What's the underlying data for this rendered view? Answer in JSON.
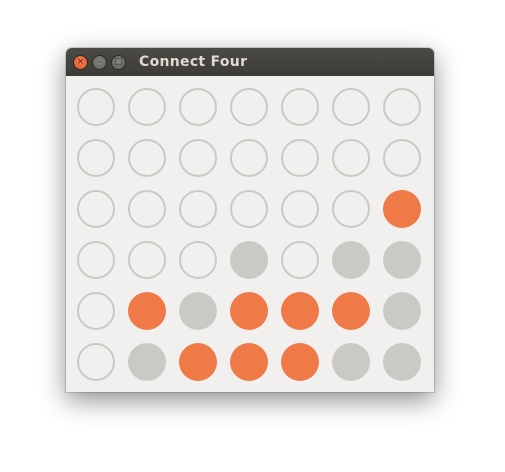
{
  "window": {
    "title": "Connect Four",
    "buttons": {
      "close_icon": "×",
      "minimize_icon": "–",
      "maximize_icon": "□"
    }
  },
  "colors": {
    "orange": "#f07a47",
    "gray": "#cbc9c6",
    "empty_outline": "#cbc9c6",
    "board_background": "#f1f0ef",
    "titlebar": "#3c3b37"
  },
  "board": {
    "rows": 6,
    "cols": 7,
    "cells": [
      [
        "empty",
        "empty",
        "empty",
        "empty",
        "empty",
        "empty",
        "empty"
      ],
      [
        "empty",
        "empty",
        "empty",
        "empty",
        "empty",
        "empty",
        "empty"
      ],
      [
        "empty",
        "empty",
        "empty",
        "empty",
        "empty",
        "empty",
        "orange"
      ],
      [
        "empty",
        "empty",
        "empty",
        "gray",
        "empty",
        "gray",
        "gray"
      ],
      [
        "empty",
        "orange",
        "gray",
        "orange",
        "orange",
        "orange",
        "gray"
      ],
      [
        "empty",
        "gray",
        "orange",
        "orange",
        "orange",
        "gray",
        "gray"
      ]
    ]
  }
}
